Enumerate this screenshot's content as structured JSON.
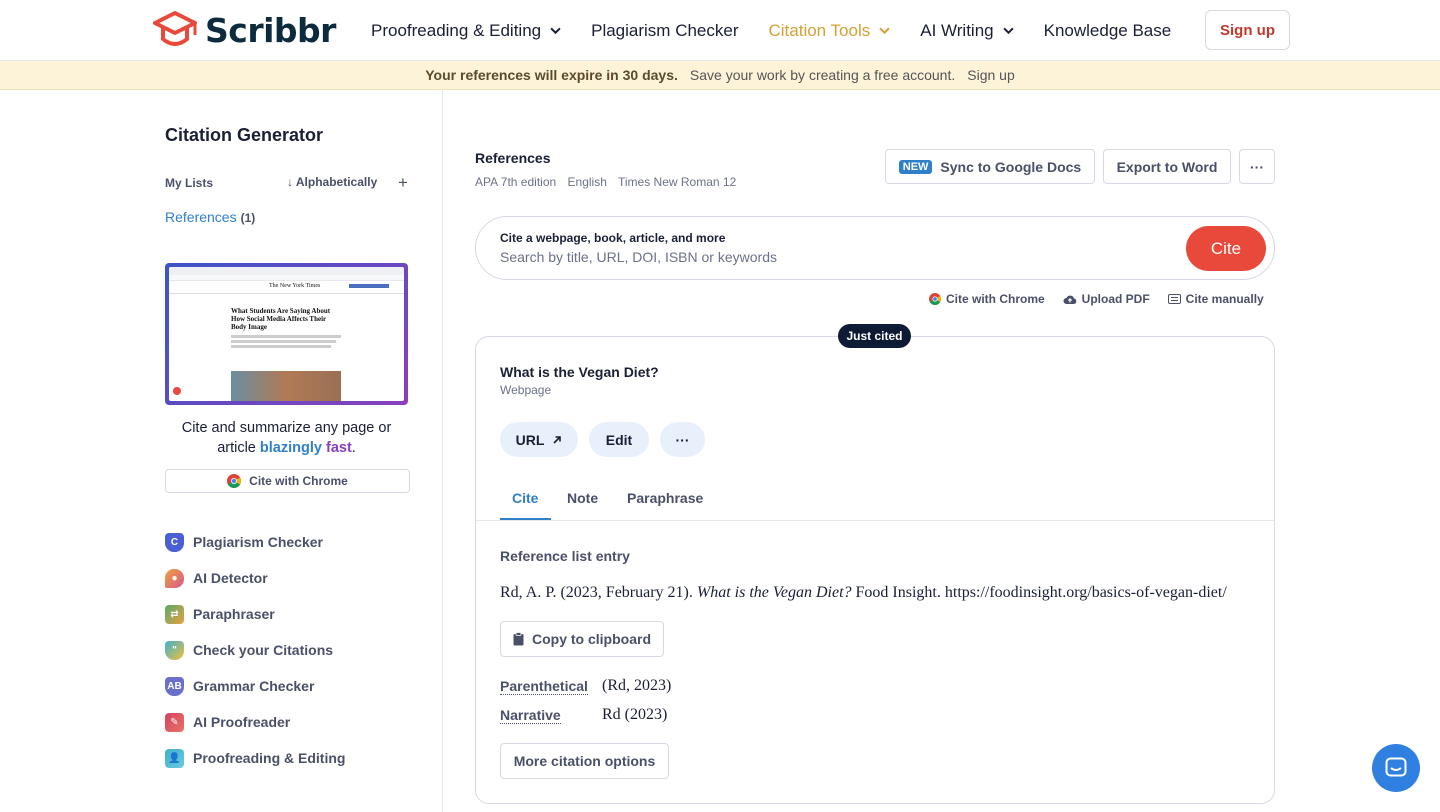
{
  "brand": {
    "name": "Scribbr",
    "logo_color": "#e8493a"
  },
  "nav": {
    "items": [
      {
        "label": "Proofreading & Editing",
        "has_dropdown": true
      },
      {
        "label": "Plagiarism Checker",
        "has_dropdown": false
      },
      {
        "label": "Citation Tools",
        "has_dropdown": true,
        "active": true
      },
      {
        "label": "AI Writing",
        "has_dropdown": true
      },
      {
        "label": "Knowledge Base",
        "has_dropdown": false
      }
    ],
    "signup_label": "Sign up",
    "active_color": "#d4a035"
  },
  "banner": {
    "bold_text": "Your references will expire in 30 days.",
    "text": "Save your work by creating a free account.",
    "link": "Sign up"
  },
  "sidebar": {
    "title": "Citation Generator",
    "my_lists_label": "My Lists",
    "sort_label": "Alphabetically",
    "add_icon": "plus-icon",
    "lists": [
      {
        "label": "References",
        "count": "(1)"
      }
    ],
    "promo": {
      "text_before": "Cite and summarize any page or article ",
      "highlight_1": "blazingly",
      "highlight_2": "fast",
      "text_after": ".",
      "button_label": "Cite with Chrome",
      "preview_headline": "What Students Are Saying About How Social Media Affects Their Body Image",
      "preview_masthead": "The New York Times"
    },
    "tools": [
      {
        "label": "Plagiarism Checker",
        "icon": "shield-icon",
        "color": "#4a5fd4"
      },
      {
        "label": "AI Detector",
        "icon": "ai-detector-icon",
        "color": "#d45a8a"
      },
      {
        "label": "Paraphraser",
        "icon": "paraphraser-icon",
        "color": "#5aaa6b"
      },
      {
        "label": "Check your Citations",
        "icon": "citation-check-icon",
        "color": "#3fb0c9"
      },
      {
        "label": "Grammar Checker",
        "icon": "grammar-icon",
        "color": "#6a6fc9"
      },
      {
        "label": "AI Proofreader",
        "icon": "proofreader-icon",
        "color": "#d4435a"
      },
      {
        "label": "Proofreading & Editing",
        "icon": "editing-icon",
        "color": "#3fb0c9"
      }
    ]
  },
  "references": {
    "title": "References",
    "meta": [
      "APA 7th edition",
      "English",
      "Times New Roman 12"
    ],
    "new_badge": "NEW",
    "sync_label": "Sync to Google Docs",
    "export_label": "Export to Word",
    "more_label": "···"
  },
  "search": {
    "label": "Cite a webpage, book, article, and more",
    "placeholder": "Search by title, URL, DOI, ISBN or keywords",
    "button": "Cite",
    "button_color": "#e8493a"
  },
  "sub_actions": [
    {
      "label": "Cite with Chrome",
      "icon": "chrome-icon"
    },
    {
      "label": "Upload PDF",
      "icon": "cloud-upload-icon"
    },
    {
      "label": "Cite manually",
      "icon": "keyboard-icon"
    }
  ],
  "citation": {
    "badge": "Just cited",
    "title": "What is the Vegan Diet?",
    "type": "Webpage",
    "url_button": "URL",
    "edit_button": "Edit",
    "more_button": "···",
    "tabs": [
      "Cite",
      "Note",
      "Paraphrase"
    ],
    "active_tab": "Cite",
    "reference_list_label": "Reference list entry",
    "entry_prefix": "Rd, A. P. (2023, February 21). ",
    "entry_title": "What is the Vegan Diet?",
    "entry_suffix": " Food Insight. https://foodinsight.org/basics-of-vegan-diet/",
    "copy_label": "Copy to clipboard",
    "parenthetical_label": "Parenthetical",
    "parenthetical_value": "(Rd, 2023)",
    "narrative_label": "Narrative",
    "narrative_value": "Rd (2023)",
    "more_options_label": "More citation options"
  },
  "chat": {
    "icon": "chat-icon"
  }
}
